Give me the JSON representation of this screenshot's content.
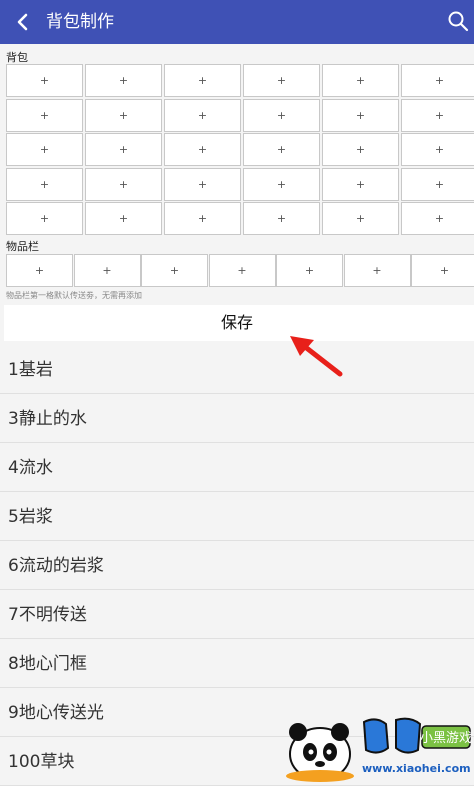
{
  "appbar": {
    "title": "背包制作",
    "back_icon": "back-arrow-icon",
    "search_icon": "search-icon",
    "color": "#3f51b5"
  },
  "backpack": {
    "label": "背包",
    "rows": [
      [
        "+",
        "+",
        "+",
        "+",
        "+",
        "+"
      ],
      [
        "+",
        "+",
        "+",
        "+",
        "+",
        "+"
      ],
      [
        "+",
        "+",
        "+",
        "+",
        "+",
        "+"
      ],
      [
        "+",
        "+",
        "+",
        "+",
        "+",
        "+"
      ],
      [
        "+",
        "+",
        "+",
        "+",
        "+",
        "+"
      ]
    ]
  },
  "items_bar": {
    "label": "物品栏",
    "cells": [
      "+",
      "+",
      "+",
      "+",
      "+",
      "+",
      "+"
    ],
    "hint": "物品栏第一格默认传送劵，无需再添加"
  },
  "save_label": "保存",
  "list": [
    "1基岩",
    "3静止的水",
    "4流水",
    "5岩浆",
    "6流动的岩浆",
    "7不明传送",
    "8地心门框",
    "9地心传送光",
    "100草块"
  ],
  "watermark": {
    "brand": "小黑游戏",
    "url": "www.xiaohei.com"
  }
}
